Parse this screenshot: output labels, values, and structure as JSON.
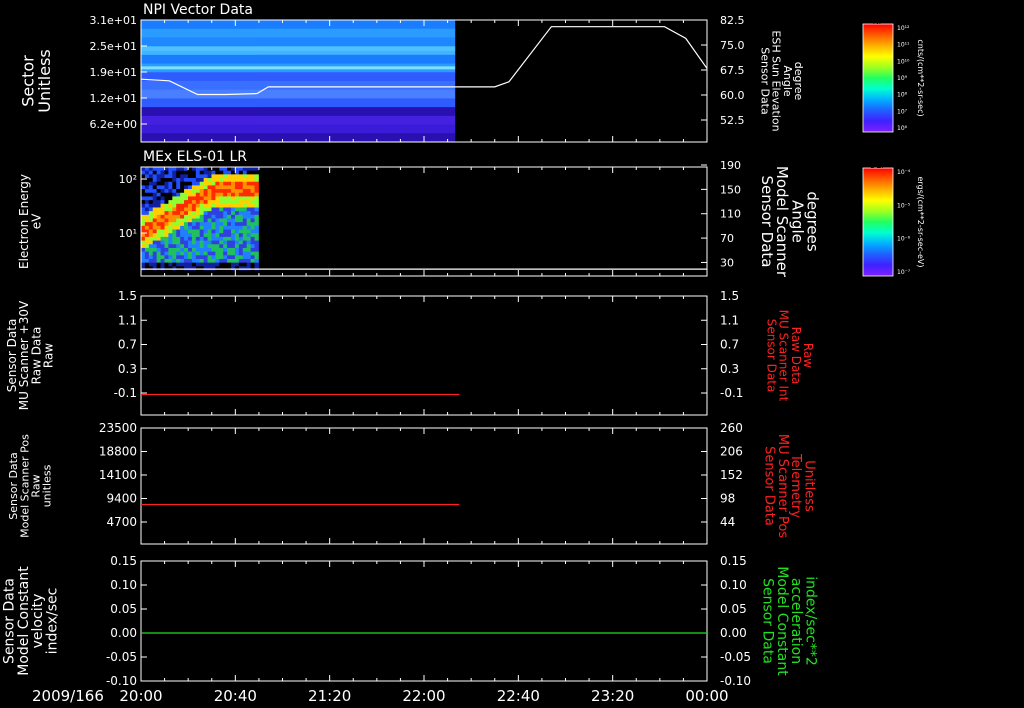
{
  "date_label": "2009/166",
  "x_ticks": [
    "20:00",
    "20:40",
    "21:20",
    "22:00",
    "22:40",
    "23:20",
    "00:00"
  ],
  "colors": {
    "white": "#ffffff",
    "red": "#ff2020",
    "green": "#20e020",
    "background": "#000000"
  },
  "colorbars": [
    {
      "tag": "NF",
      "unit": "cnts/(cm**2-sr-sec)",
      "ticks": [
        "10¹²",
        "10¹¹",
        "10¹⁰",
        "10⁹",
        "10⁸",
        "10⁷",
        "10⁶"
      ]
    },
    {
      "tag": "DEF",
      "unit": "ergs/(cm**2-sr-sec-eV)",
      "ticks": [
        "10⁻⁴",
        "10⁻⁵",
        "10⁻⁶",
        "10⁻⁷"
      ]
    }
  ],
  "chart_data": [
    {
      "type": "heatmap",
      "title": "NPI Vector Data",
      "ylabel": [
        "Sector",
        "Unitless"
      ],
      "y_ticks": [
        "3.1e+01",
        "2.5e+01",
        "1.9e+01",
        "1.2e+01",
        "6.2e+00"
      ],
      "right_ylabel": [
        "Sensor Data",
        "ESH Sun Elevation",
        "Angle",
        "degree"
      ],
      "right_ticks": [
        "82.5",
        "75.0",
        "67.5",
        "60.0",
        "52.5"
      ],
      "right_ylim": [
        46,
        82.5
      ],
      "data_extent_hours": [
        20.0,
        22.22
      ],
      "overlay_line": {
        "x": [
          20.0,
          20.2,
          20.4,
          20.6,
          20.82,
          20.9,
          21.5,
          22.0,
          22.5,
          22.6,
          22.9,
          23.2,
          23.5,
          23.7,
          23.85,
          24.0
        ],
        "y": [
          64.8,
          64.3,
          60.2,
          60.2,
          60.5,
          62.5,
          62.5,
          62.5,
          62.5,
          64.0,
          80.5,
          80.5,
          80.5,
          80.5,
          77.0,
          68.0
        ]
      }
    },
    {
      "type": "heatmap",
      "title": "MEx ELS-01 LR",
      "ylabel": [
        "Electron Energy",
        "eV"
      ],
      "y_ticks": [
        "10²",
        "10¹"
      ],
      "right_ylabel": [
        "Sensor Data",
        "Model Scanner",
        "Angle",
        "degrees"
      ],
      "right_ticks": [
        "190",
        "150",
        "110",
        "70",
        "30"
      ],
      "right_ylim": [
        0,
        190
      ],
      "data_extent_hours": [
        20.0,
        20.83
      ],
      "overlay_line": {
        "x": [
          20.0,
          24.0
        ],
        "y": [
          12,
          12
        ]
      }
    },
    {
      "type": "line",
      "ylabel": [
        "Sensor Data",
        "MU Scanner +30V",
        "Raw Data",
        "Raw"
      ],
      "y_ticks": [
        "1.5",
        "1.1",
        "0.7",
        "0.3",
        "-0.1"
      ],
      "ylim": [
        -0.35,
        1.5
      ],
      "right_ylabel": [
        "Sensor Data",
        "MU Scanner Int",
        "Raw Data",
        "Raw"
      ],
      "right_ticks": [
        "1.5",
        "1.1",
        "0.7",
        "0.3",
        "-0.1"
      ],
      "series": [
        {
          "x": [
            20.0,
            22.25
          ],
          "y": [
            -0.03,
            -0.03
          ]
        }
      ]
    },
    {
      "type": "line",
      "ylabel": [
        "Sensor Data",
        "Model Scanner Pos",
        "Raw",
        "unitless"
      ],
      "y_ticks": [
        "23500",
        "18800",
        "14100",
        "9400",
        "4700"
      ],
      "ylim": [
        0,
        23500
      ],
      "right_ylabel": [
        "Sensor Data",
        "MU Scanner Pos",
        "Telemetry",
        "Unitless"
      ],
      "right_ticks": [
        "260",
        "206",
        "152",
        "98",
        "44"
      ],
      "series": [
        {
          "x": [
            20.0,
            22.25
          ],
          "y": [
            8000,
            8000
          ]
        }
      ]
    },
    {
      "type": "line",
      "ylabel": [
        "Sensor Data",
        "Model Constant",
        "velocity",
        "index/sec"
      ],
      "y_ticks": [
        "0.15",
        "0.10",
        "0.05",
        "0.00",
        "-0.05",
        "-0.10"
      ],
      "ylim": [
        -0.1,
        0.15
      ],
      "right_ylabel": [
        "Sensor Data",
        "Model Constant",
        "acceleration",
        "index/sec**2"
      ],
      "right_ticks": [
        "0.15",
        "0.10",
        "0.05",
        "0.00",
        "-0.05",
        "-0.10"
      ],
      "series": [
        {
          "x": [
            20.0,
            24.0
          ],
          "y": [
            0.0,
            0.0
          ]
        }
      ]
    }
  ]
}
